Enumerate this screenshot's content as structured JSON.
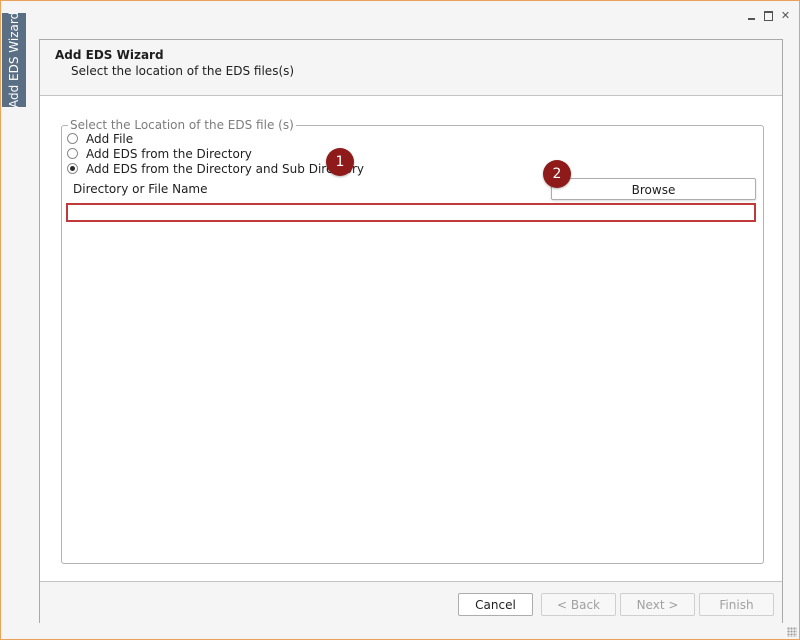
{
  "window": {
    "side_tab_label": "Add EDS Wizard",
    "controls": {
      "minimize_icon": "minimize-icon",
      "maximize_icon": "maximize-icon",
      "close_glyph": "✕"
    }
  },
  "header": {
    "title": "Add EDS Wizard",
    "subtitle": "Select the location of the EDS files(s)"
  },
  "group": {
    "legend": "Select the Location of the EDS file (s)",
    "options": [
      {
        "label": "Add File",
        "selected": false
      },
      {
        "label": "Add EDS from the Directory",
        "selected": false
      },
      {
        "label": "Add EDS from the Directory and Sub Directory",
        "selected": true
      }
    ],
    "field_label": "Directory or File Name",
    "path_value": "",
    "browse_label": "Browse"
  },
  "badges": [
    "1",
    "2"
  ],
  "footer": {
    "cancel_label": "Cancel",
    "back_label": "< Back",
    "next_label": "Next >",
    "finish_label": "Finish"
  },
  "colors": {
    "window_border": "#e8a25a",
    "side_tab": "#5a6e84",
    "badge": "#8e1a1a",
    "validation_border": "#c0393b"
  }
}
